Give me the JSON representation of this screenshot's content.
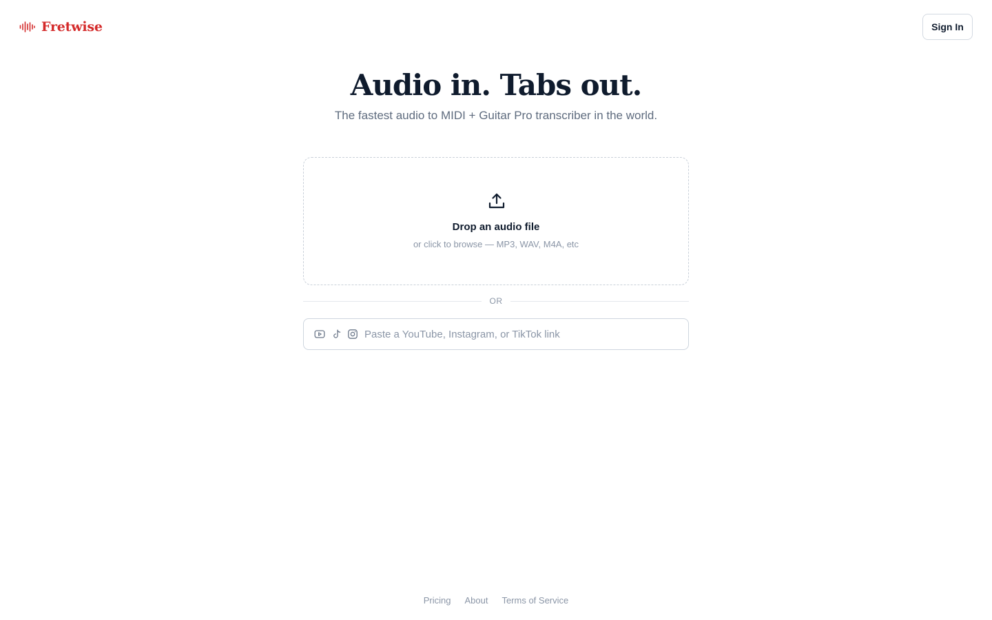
{
  "brand": {
    "name": "Fretwise",
    "icon": "sound-wave-icon",
    "color": "#d42a2a"
  },
  "header": {
    "signin_label": "Sign In"
  },
  "hero": {
    "title": "Audio in. Tabs out.",
    "subtitle": "The fastest audio to MIDI + Guitar Pro transcriber in the world."
  },
  "dropzone": {
    "icon": "upload-icon",
    "title": "Drop an audio file",
    "subtitle": "or click to browse — MP3, WAV, M4A, etc"
  },
  "divider": {
    "label": "OR"
  },
  "link_input": {
    "placeholder": "Paste a YouTube, Instagram, or TikTok link",
    "value": "",
    "icons": [
      "youtube-icon",
      "tiktok-icon",
      "instagram-icon"
    ]
  },
  "footer": {
    "links": [
      {
        "label": "Pricing"
      },
      {
        "label": "About"
      },
      {
        "label": "Terms of Service"
      }
    ]
  },
  "colors": {
    "accent": "#d42a2a",
    "text": "#0f1b2d",
    "muted": "#8a95a6",
    "subtitle": "#5e6b7e",
    "border": "#cdd5de"
  }
}
